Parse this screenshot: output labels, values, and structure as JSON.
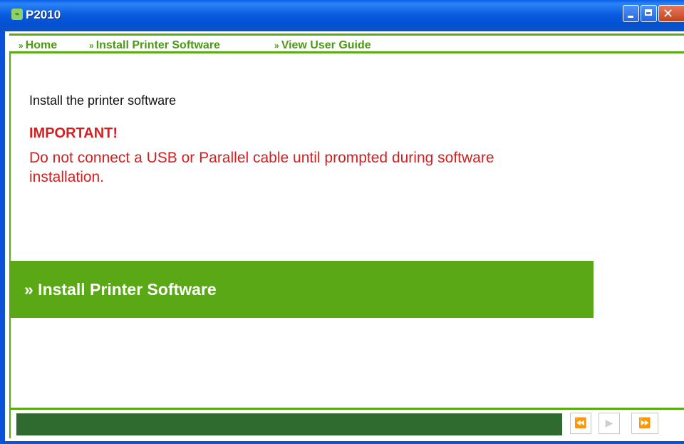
{
  "window": {
    "title": "P2010",
    "app_icon": "hp-logo"
  },
  "nav": {
    "marker": "»",
    "items": [
      "Home",
      "Install Printer Software",
      "View User Guide"
    ]
  },
  "content": {
    "heading": "Install the printer software",
    "important_label": "IMPORTANT!",
    "warning_text": "Do not connect a USB or Parallel cable until prompted during software installation."
  },
  "banner": {
    "label": "» Install Printer Software"
  },
  "controls": {
    "rewind": "⏪",
    "play": "▶",
    "forward": "⏩"
  },
  "colors": {
    "accent_green": "#5aa816",
    "warning_red": "#d31f1f",
    "dark_green_bar": "#2f6a2f",
    "xp_blue": "#0b52d8"
  }
}
